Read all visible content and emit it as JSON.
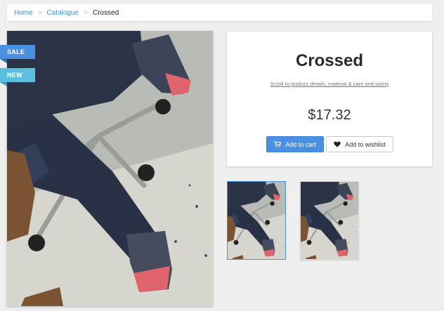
{
  "breadcrumb": {
    "items": [
      {
        "label": "Home"
      },
      {
        "label": "Catalogue"
      }
    ],
    "separator": ">",
    "current": "Crossed"
  },
  "badges": {
    "sale": "SALE",
    "new": "NEW"
  },
  "product": {
    "title": "Crossed",
    "scroll_link": "Scroll to product details, material & care and sizing",
    "price": "$17.32",
    "add_to_cart": "Add to cart",
    "add_to_wishlist": "Add to wishlist"
  },
  "thumbnails": [
    {
      "selected": true
    },
    {
      "selected": false
    }
  ],
  "colors": {
    "accent": "#4a90e2",
    "new_badge": "#5bc0de",
    "background": "#efefef"
  },
  "icons": {
    "cart": "shopping-cart-icon",
    "wishlist": "heart-icon"
  }
}
